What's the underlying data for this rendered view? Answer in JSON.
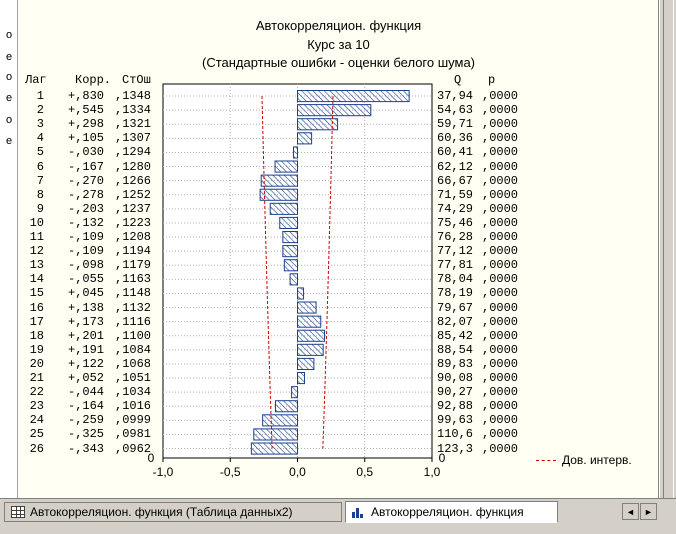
{
  "left_fragments": [
    "о",
    "е",
    "о",
    "е",
    "о",
    "е"
  ],
  "chart_data": {
    "type": "bar",
    "orientation": "horizontal",
    "title_lines": [
      "Автокорреляцион. функция",
      "Курс за 10",
      "(Стандартные ошибки - оценки белого шума)"
    ],
    "column_headers": {
      "lag": "Лаг",
      "corr": "Корр.",
      "se": "СтОш",
      "q": "Q",
      "p": "p"
    },
    "rows": [
      {
        "lag": "1",
        "corr": "+,830",
        "se": ",1348",
        "q": "37,94",
        "p": ",0000",
        "value": 0.83,
        "se_value": 0.1348
      },
      {
        "lag": "2",
        "corr": "+,545",
        "se": ",1334",
        "q": "54,63",
        "p": ",0000",
        "value": 0.545,
        "se_value": 0.1334
      },
      {
        "lag": "3",
        "corr": "+,298",
        "se": ",1321",
        "q": "59,71",
        "p": ",0000",
        "value": 0.298,
        "se_value": 0.1321
      },
      {
        "lag": "4",
        "corr": "+,105",
        "se": ",1307",
        "q": "60,36",
        "p": ",0000",
        "value": 0.105,
        "se_value": 0.1307
      },
      {
        "lag": "5",
        "corr": "-,030",
        "se": ",1294",
        "q": "60,41",
        "p": ",0000",
        "value": -0.03,
        "se_value": 0.1294
      },
      {
        "lag": "6",
        "corr": "-,167",
        "se": ",1280",
        "q": "62,12",
        "p": ",0000",
        "value": -0.167,
        "se_value": 0.128
      },
      {
        "lag": "7",
        "corr": "-,270",
        "se": ",1266",
        "q": "66,67",
        "p": ",0000",
        "value": -0.27,
        "se_value": 0.1266
      },
      {
        "lag": "8",
        "corr": "-,278",
        "se": ",1252",
        "q": "71,59",
        "p": ",0000",
        "value": -0.278,
        "se_value": 0.1252
      },
      {
        "lag": "9",
        "corr": "-,203",
        "se": ",1237",
        "q": "74,29",
        "p": ",0000",
        "value": -0.203,
        "se_value": 0.1237
      },
      {
        "lag": "10",
        "corr": "-,132",
        "se": ",1223",
        "q": "75,46",
        "p": ",0000",
        "value": -0.132,
        "se_value": 0.1223
      },
      {
        "lag": "11",
        "corr": "-,109",
        "se": ",1208",
        "q": "76,28",
        "p": ",0000",
        "value": -0.109,
        "se_value": 0.1208
      },
      {
        "lag": "12",
        "corr": "-,109",
        "se": ",1194",
        "q": "77,12",
        "p": ",0000",
        "value": -0.109,
        "se_value": 0.1194
      },
      {
        "lag": "13",
        "corr": "-,098",
        "se": ",1179",
        "q": "77,81",
        "p": ",0000",
        "value": -0.098,
        "se_value": 0.1179
      },
      {
        "lag": "14",
        "corr": "-,055",
        "se": ",1163",
        "q": "78,04",
        "p": ",0000",
        "value": -0.055,
        "se_value": 0.1163
      },
      {
        "lag": "15",
        "corr": "+,045",
        "se": ",1148",
        "q": "78,19",
        "p": ",0000",
        "value": 0.045,
        "se_value": 0.1148
      },
      {
        "lag": "16",
        "corr": "+,138",
        "se": ",1132",
        "q": "79,67",
        "p": ",0000",
        "value": 0.138,
        "se_value": 0.1132
      },
      {
        "lag": "17",
        "corr": "+,173",
        "se": ",1116",
        "q": "82,07",
        "p": ",0000",
        "value": 0.173,
        "se_value": 0.1116
      },
      {
        "lag": "18",
        "corr": "+,201",
        "se": ",1100",
        "q": "85,42",
        "p": ",0000",
        "value": 0.201,
        "se_value": 0.11
      },
      {
        "lag": "19",
        "corr": "+,191",
        "se": ",1084",
        "q": "88,54",
        "p": ",0000",
        "value": 0.191,
        "se_value": 0.1084
      },
      {
        "lag": "20",
        "corr": "+,122",
        "se": ",1068",
        "q": "89,83",
        "p": ",0000",
        "value": 0.122,
        "se_value": 0.1068
      },
      {
        "lag": "21",
        "corr": "+,052",
        "se": ",1051",
        "q": "90,08",
        "p": ",0000",
        "value": 0.052,
        "se_value": 0.1051
      },
      {
        "lag": "22",
        "corr": "-,044",
        "se": ",1034",
        "q": "90,27",
        "p": ",0000",
        "value": -0.044,
        "se_value": 0.1034
      },
      {
        "lag": "23",
        "corr": "-,164",
        "se": ",1016",
        "q": "92,88",
        "p": ",0000",
        "value": -0.164,
        "se_value": 0.1016
      },
      {
        "lag": "24",
        "corr": "-,259",
        "se": ",0999",
        "q": "99,63",
        "p": ",0000",
        "value": -0.259,
        "se_value": 0.0999
      },
      {
        "lag": "25",
        "corr": "-,325",
        "se": ",0981",
        "q": "110,6",
        "p": ",0000",
        "value": -0.325,
        "se_value": 0.0981
      },
      {
        "lag": "26",
        "corr": "-,343",
        "se": ",0962",
        "q": "123,3",
        "p": ",0000",
        "value": -0.343,
        "se_value": 0.0962
      }
    ],
    "xlim": [
      -1.0,
      1.0
    ],
    "xticks": [
      "-1,0",
      "-0,5",
      "0,0",
      "0,5",
      "1,0"
    ],
    "xtick_values": [
      -1.0,
      -0.5,
      0.0,
      0.5,
      1.0
    ],
    "ylim_labels": [
      "0",
      "0"
    ],
    "confidence_multiplier": 1.96,
    "grid": true,
    "legend_position": "bottom-right",
    "legend": {
      "label": "Дов. интерв."
    },
    "colors": {
      "bar_stroke": "#1c3f8f",
      "bar_hatch": "#1c3f8f",
      "conf_line": "#cc0000",
      "grid": "#b0b0b0"
    }
  },
  "tabs": [
    {
      "label": "Автокорреляцион. функция (Таблица данных2)",
      "icon": "table-icon",
      "active": false
    },
    {
      "label": "Автокорреляцион. функция",
      "icon": "graph-icon",
      "active": true
    }
  ],
  "scroll": {
    "left": "◄",
    "right": "►"
  }
}
